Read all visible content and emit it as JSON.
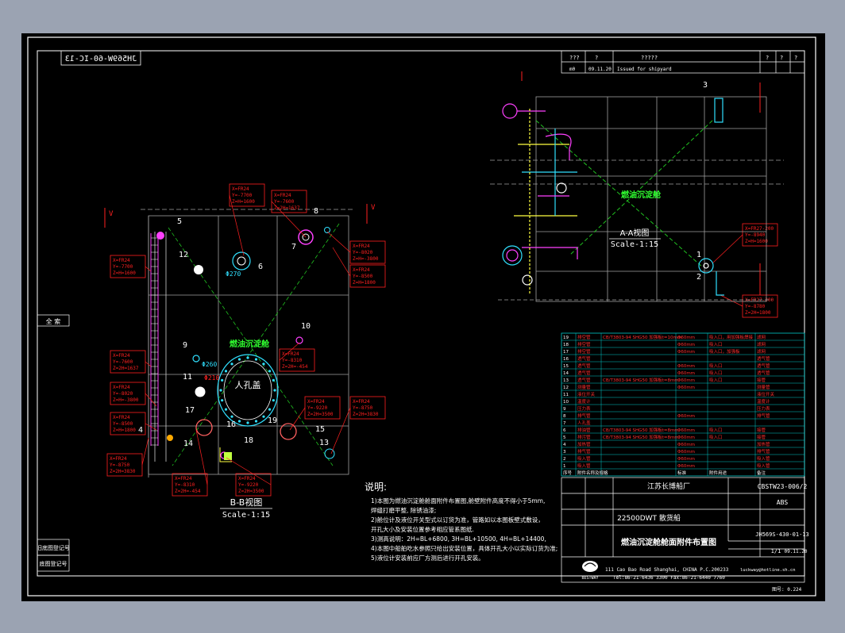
{
  "drawing": {
    "drawing_no_mirrored": "JH569W-60-IC-13",
    "section_bb_title": "B-B视图",
    "section_bb_scale": "Scale-1:15",
    "section_aa_title": "A-A视图",
    "section_aa_scale": "Scale-1:15",
    "tank_name": "燃油沉淀舱",
    "manhole_label": "人孔盖",
    "dimension_a": "Φ270",
    "dimension_b": "Φ260",
    "dimension_c": "Φ210",
    "marker_v": "V"
  },
  "part_numbers": [
    "1",
    "2",
    "3",
    "4",
    "5",
    "6",
    "7",
    "8",
    "9",
    "10",
    "11",
    "12",
    "13",
    "14",
    "15",
    "16",
    "17",
    "18",
    "19"
  ],
  "callouts": {
    "c1": [
      "X=FR24",
      "Y=-7700",
      "Z=H=1600"
    ],
    "c2": [
      "X=FR24",
      "Y=-7600",
      "Z=2H=1637"
    ],
    "c3": [
      "X=FR24",
      "Y=-8020",
      "Z=H=-3800"
    ],
    "c4": [
      "X=FR24",
      "Y=-8500",
      "Z=H=1800"
    ],
    "c5": [
      "X=FR27-200",
      "Y=-8940",
      "Z=H=1600"
    ],
    "c6": [
      "X=FR27-200",
      "Y=-8780",
      "Z=2H=1800"
    ],
    "c7": [
      "X=FR24",
      "Y=-8310",
      "Z=2H=-454"
    ],
    "c8": [
      "X=FR24",
      "Y=-9220",
      "Z=2H=3500"
    ],
    "c9": [
      "X=FR24",
      "Y=-8750",
      "Z=2H=3830"
    ]
  },
  "title_block": {
    "revision_row": [
      "???",
      "?",
      "?????",
      "?",
      "?",
      "?"
    ],
    "revision_row2": [
      "m0",
      "09.11.20",
      "Issued for shipyard"
    ],
    "shipyard": "江苏长博船厂",
    "drawing_code": "CBSTW23-006/2",
    "class_society": "ABS",
    "vessel": "22500DWT 散货船",
    "drawing_title": "燃油沉淀舱舱面附件布置图",
    "drawing_number": "JH569S-430-01-13",
    "sheet": "1/1",
    "date": "09.11.20",
    "company_address": "111 Cao Bao Road Shanghai, CHINA    P.C.200233",
    "company_tel": "Tel:86-21-6436 3300   Fax:86-21-6440 7760",
    "company_email": "luckway@hotline.sh.cn",
    "company_logo_text": "BESTWAY",
    "scale_text": "图号: 0.224"
  },
  "parts_table": {
    "rows": [
      [
        "19",
        "排空管",
        "CB/T3803-94 SHG50 加强板t=10mm",
        "Φ60mm",
        "吸入口，用加强板焊接",
        "滤网"
      ],
      [
        "18",
        "排空管",
        "",
        "Φ60mm",
        "吸入口",
        "滤网"
      ],
      [
        "17",
        "排空管",
        "",
        "Φ60mm",
        "吸入口，加强板",
        "滤网"
      ],
      [
        "16",
        "透气管",
        "",
        "",
        "",
        "透气管"
      ],
      [
        "15",
        "透气管",
        "",
        "Φ60mm",
        "吸入口",
        "透气管"
      ],
      [
        "14",
        "透气管",
        "",
        "Φ60mm",
        "吸入口",
        "透气管"
      ],
      [
        "13",
        "透气管",
        "CB/T3803-94 SHG50 加强板t=8mm",
        "Φ60mm",
        "吸入口",
        "接管"
      ],
      [
        "12",
        "测量管",
        "",
        "Φ60mm",
        "",
        "测量管"
      ],
      [
        "11",
        "液位开关",
        "",
        "",
        "",
        "液位开关"
      ],
      [
        "10",
        "温度计",
        "",
        "",
        "",
        "温度计"
      ],
      [
        "9",
        "压力表",
        "",
        "",
        "",
        "压力表"
      ],
      [
        "8",
        "排气管",
        "",
        "Φ60mm",
        "",
        "排气管"
      ],
      [
        "7",
        "人孔盖",
        "",
        "",
        "",
        ""
      ],
      [
        "6",
        "排油管",
        "CB/T3803-94 SHG50 加强板t=8mm",
        "Φ60mm",
        "吸入口",
        "接管"
      ],
      [
        "5",
        "排污管",
        "CB/T3803-94 SHG50 加强板t=8mm",
        "Φ60mm",
        "吸入口",
        "接管"
      ],
      [
        "4",
        "加热管",
        "",
        "Φ60mm",
        "",
        "加热管"
      ],
      [
        "3",
        "排气管",
        "",
        "Φ60mm",
        "",
        "排气管"
      ],
      [
        "2",
        "吸入管",
        "",
        "Φ60mm",
        "",
        "吸入管"
      ],
      [
        "1",
        "吸入管",
        "",
        "Φ60mm",
        "",
        "吸入管"
      ]
    ],
    "header": [
      "序号",
      "附件名称及规格",
      "",
      "标准",
      "附件用途",
      "备注"
    ]
  },
  "notes": {
    "title": "说明:",
    "lines": [
      "1)本图为燃油沉淀舱舱面附件布置图,舱壁附件高度不得小于5mm,",
      "   焊缝打磨平整, 除锈油漆;",
      "2)舱位计及液位开关型式以订货为准，管路如以本图板壁式敷设，",
      "   开孔大小及安装位置参考相应管系图纸.",
      "3)测高说明：2H=BL+6800, 3H=BL+10500, 4H=BL+14400,",
      "4)本图中船舶吃水参照只给出安装位置，具体开孔大小以实际订货为准;",
      "5)液位计安装前应厂方测后进行开孔安装。"
    ]
  },
  "left_strip": {
    "top_label": "全  索",
    "bottom_label1": "旧底图登记号",
    "bottom_label2": "底图登记号"
  },
  "colors": {
    "background": "#000000",
    "frame": "#ffffff",
    "callout_red": "#ff2020",
    "pipe_magenta": "#ff40ff",
    "pipe_cyan": "#30e0ff",
    "pipe_yellow": "#ffff40",
    "hull_gray": "#a0a0a0",
    "diagonal_green": "#20c020",
    "table_cyan": "#00c8c8",
    "tank_text_green": "#30ff30"
  },
  "icons": [
    "cad-logo-icon",
    "arrow-marker-icon"
  ]
}
